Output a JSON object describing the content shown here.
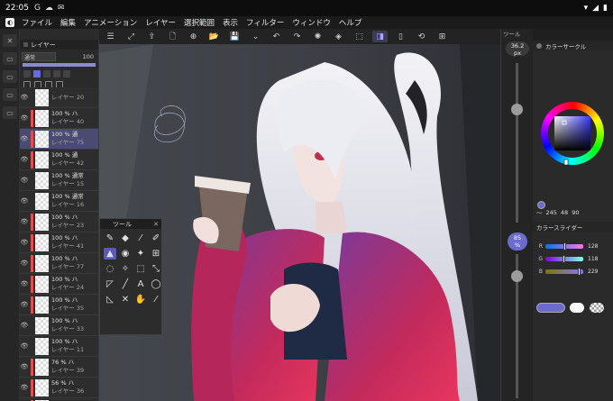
{
  "status_bar": {
    "time": "22:05",
    "icons": [
      "G",
      "☁",
      "✉"
    ],
    "right_icons": [
      "▾",
      "◢",
      "▮"
    ]
  },
  "menu": {
    "items": [
      "ファイル",
      "編集",
      "アニメーション",
      "レイヤー",
      "選択範囲",
      "表示",
      "フィルター",
      "ウィンドウ",
      "ヘルプ"
    ]
  },
  "toolbar": {
    "buttons": [
      {
        "name": "menu-icon",
        "glyph": "☰"
      },
      {
        "name": "fit-icon",
        "glyph": "⤢"
      },
      {
        "name": "export-icon",
        "glyph": "⇪"
      },
      {
        "name": "file-icon",
        "glyph": "🗋"
      },
      {
        "name": "new-icon",
        "glyph": "⊕"
      },
      {
        "name": "folder-icon",
        "glyph": "📂"
      },
      {
        "name": "save-icon",
        "glyph": "💾"
      },
      {
        "name": "dropdown-icon",
        "glyph": "⌄"
      },
      {
        "name": "undo-icon",
        "glyph": "↶"
      },
      {
        "name": "redo-icon",
        "glyph": "↷"
      },
      {
        "name": "settings-icon",
        "glyph": "✺"
      },
      {
        "name": "fill-icon",
        "glyph": "◈"
      },
      {
        "name": "transform-icon",
        "glyph": "⬚"
      },
      {
        "name": "flip-icon",
        "glyph": "◨"
      },
      {
        "name": "phone-icon",
        "glyph": "▯"
      },
      {
        "name": "sync-icon",
        "glyph": "⟲"
      },
      {
        "name": "grid-icon",
        "glyph": "⊞"
      }
    ],
    "active_index": 13
  },
  "left_strip": {
    "buttons": [
      "✕",
      "▭",
      "▭",
      "▭",
      "▭"
    ]
  },
  "layer_panel": {
    "title": "レイヤー",
    "blend_mode": "通常",
    "opacity": "100",
    "opacity_fraction": 1.0,
    "layers": [
      {
        "opacity": "",
        "name": "レイヤー 20",
        "clip": false,
        "selected": false
      },
      {
        "opacity": "100 % ハ",
        "name": "レイヤー 40",
        "clip": true,
        "selected": false
      },
      {
        "opacity": "100 % 通",
        "name": "レイヤー 75",
        "clip": true,
        "selected": true
      },
      {
        "opacity": "100 % 通",
        "name": "レイヤー 42",
        "clip": true,
        "selected": false
      },
      {
        "opacity": "100 % 通常",
        "name": "レイヤー 15",
        "clip": false,
        "selected": false
      },
      {
        "opacity": "100 % 通常",
        "name": "レイヤー 16",
        "clip": false,
        "selected": false
      },
      {
        "opacity": "100 % ハ",
        "name": "レイヤー 23",
        "clip": true,
        "selected": false
      },
      {
        "opacity": "100 % ハ",
        "name": "レイヤー 41",
        "clip": true,
        "selected": false
      },
      {
        "opacity": "100 % ハ",
        "name": "レイヤー 77",
        "clip": true,
        "selected": false
      },
      {
        "opacity": "100 % ハ",
        "name": "レイヤー 24",
        "clip": true,
        "selected": false
      },
      {
        "opacity": "100 % ハ",
        "name": "レイヤー 35",
        "clip": true,
        "selected": false
      },
      {
        "opacity": "100 % ハ",
        "name": "レイヤー 33",
        "clip": false,
        "selected": false
      },
      {
        "opacity": "100 % ハ",
        "name": "レイヤー 11",
        "clip": false,
        "selected": false
      },
      {
        "opacity": "76 % ハ",
        "name": "レイヤー 39",
        "clip": true,
        "selected": false
      },
      {
        "opacity": "56 % ハ",
        "name": "レイヤー 36",
        "clip": true,
        "selected": false
      },
      {
        "opacity": "100 % ハ",
        "name": "レイヤー",
        "clip": true,
        "selected": false
      }
    ]
  },
  "tool_panel": {
    "title": "ツール",
    "tools": [
      {
        "name": "pen-icon",
        "glyph": "✎"
      },
      {
        "name": "eraser-icon",
        "glyph": "◆"
      },
      {
        "name": "eyedropper-icon",
        "glyph": "⁄"
      },
      {
        "name": "brush-icon",
        "glyph": "✐"
      },
      {
        "name": "fill-tool-icon",
        "glyph": "▲"
      },
      {
        "name": "blend-icon",
        "glyph": "◉"
      },
      {
        "name": "sparkle-icon",
        "glyph": "✦"
      },
      {
        "name": "move-layer-icon",
        "glyph": "⊞"
      },
      {
        "name": "lasso-icon",
        "glyph": "◌"
      },
      {
        "name": "wand-icon",
        "glyph": "✧"
      },
      {
        "name": "select-rect-icon",
        "glyph": "⬚"
      },
      {
        "name": "transform-tool-icon",
        "glyph": "⤡"
      },
      {
        "name": "ruler-icon",
        "glyph": "◸"
      },
      {
        "name": "line-icon",
        "glyph": "╱"
      },
      {
        "name": "text-icon",
        "glyph": "A"
      },
      {
        "name": "balloon-icon",
        "glyph": "◯"
      },
      {
        "name": "frame-icon",
        "glyph": "◺"
      },
      {
        "name": "vector-icon",
        "glyph": "✕"
      },
      {
        "name": "hand-icon",
        "glyph": "✋"
      },
      {
        "name": "picker-icon",
        "glyph": "⁄"
      }
    ],
    "active_index": 4
  },
  "brush_panel": {
    "title": "ツール",
    "size_value": "36.2",
    "size_unit": "px",
    "size_fraction": 0.71,
    "opacity_value": "85",
    "opacity_unit": "%",
    "opacity_fraction": 0.85
  },
  "color_panel": {
    "title": "カラーサークル",
    "hue": 240,
    "info": {
      "h": "245",
      "s": "48",
      "v": "90"
    },
    "main_color": "#6c6ccf",
    "sub_color": "#ffffff",
    "slider_title": "カラースライダー",
    "rgb": [
      {
        "label": "R",
        "value": "128",
        "fraction": 0.502
      },
      {
        "label": "G",
        "value": "118",
        "fraction": 0.463
      },
      {
        "label": "B",
        "value": "229",
        "fraction": 0.898
      }
    ]
  },
  "colors": {
    "accent": "#6c6ccf",
    "selected_layer": "#4a4a72",
    "clip_marker": "#e05050"
  }
}
